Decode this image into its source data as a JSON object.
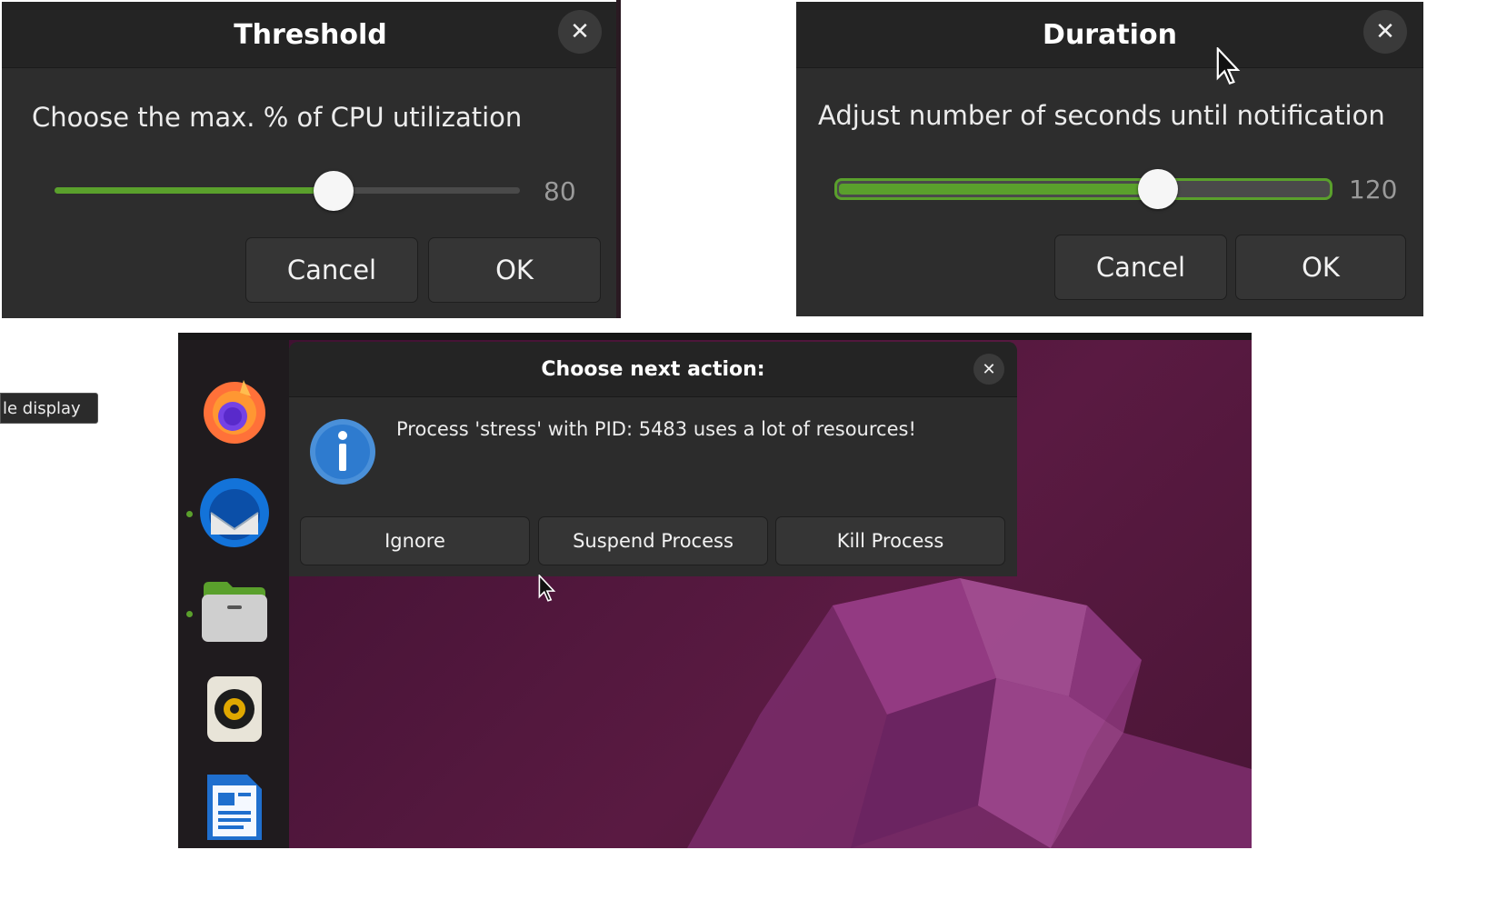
{
  "threshold": {
    "title": "Threshold",
    "prompt": "Choose the max. % of CPU utilization",
    "value_label": "80",
    "slider_fraction": 0.6,
    "cancel_label": "Cancel",
    "ok_label": "OK"
  },
  "duration": {
    "title": "Duration",
    "prompt": "Adjust number of seconds until notification",
    "value_label": "120",
    "slider_fraction": 0.65,
    "cancel_label": "Cancel",
    "ok_label": "OK"
  },
  "tooltip": {
    "text": "le display"
  },
  "action_dialog": {
    "title": "Choose next action:",
    "message": "Process 'stress' with PID: 5483 uses a lot of resources!",
    "ignore_label": "Ignore",
    "suspend_label": "Suspend Process",
    "kill_label": "Kill Process"
  },
  "dock": {
    "items": [
      "firefox-icon",
      "thunderbird-icon",
      "files-icon",
      "rhythmbox-icon",
      "writer-icon"
    ]
  },
  "colors": {
    "accent": "#5aa02c",
    "dialog_bg": "#2d2d2d",
    "titlebar_bg": "#242424",
    "desktop_bg": "#4a1536"
  }
}
